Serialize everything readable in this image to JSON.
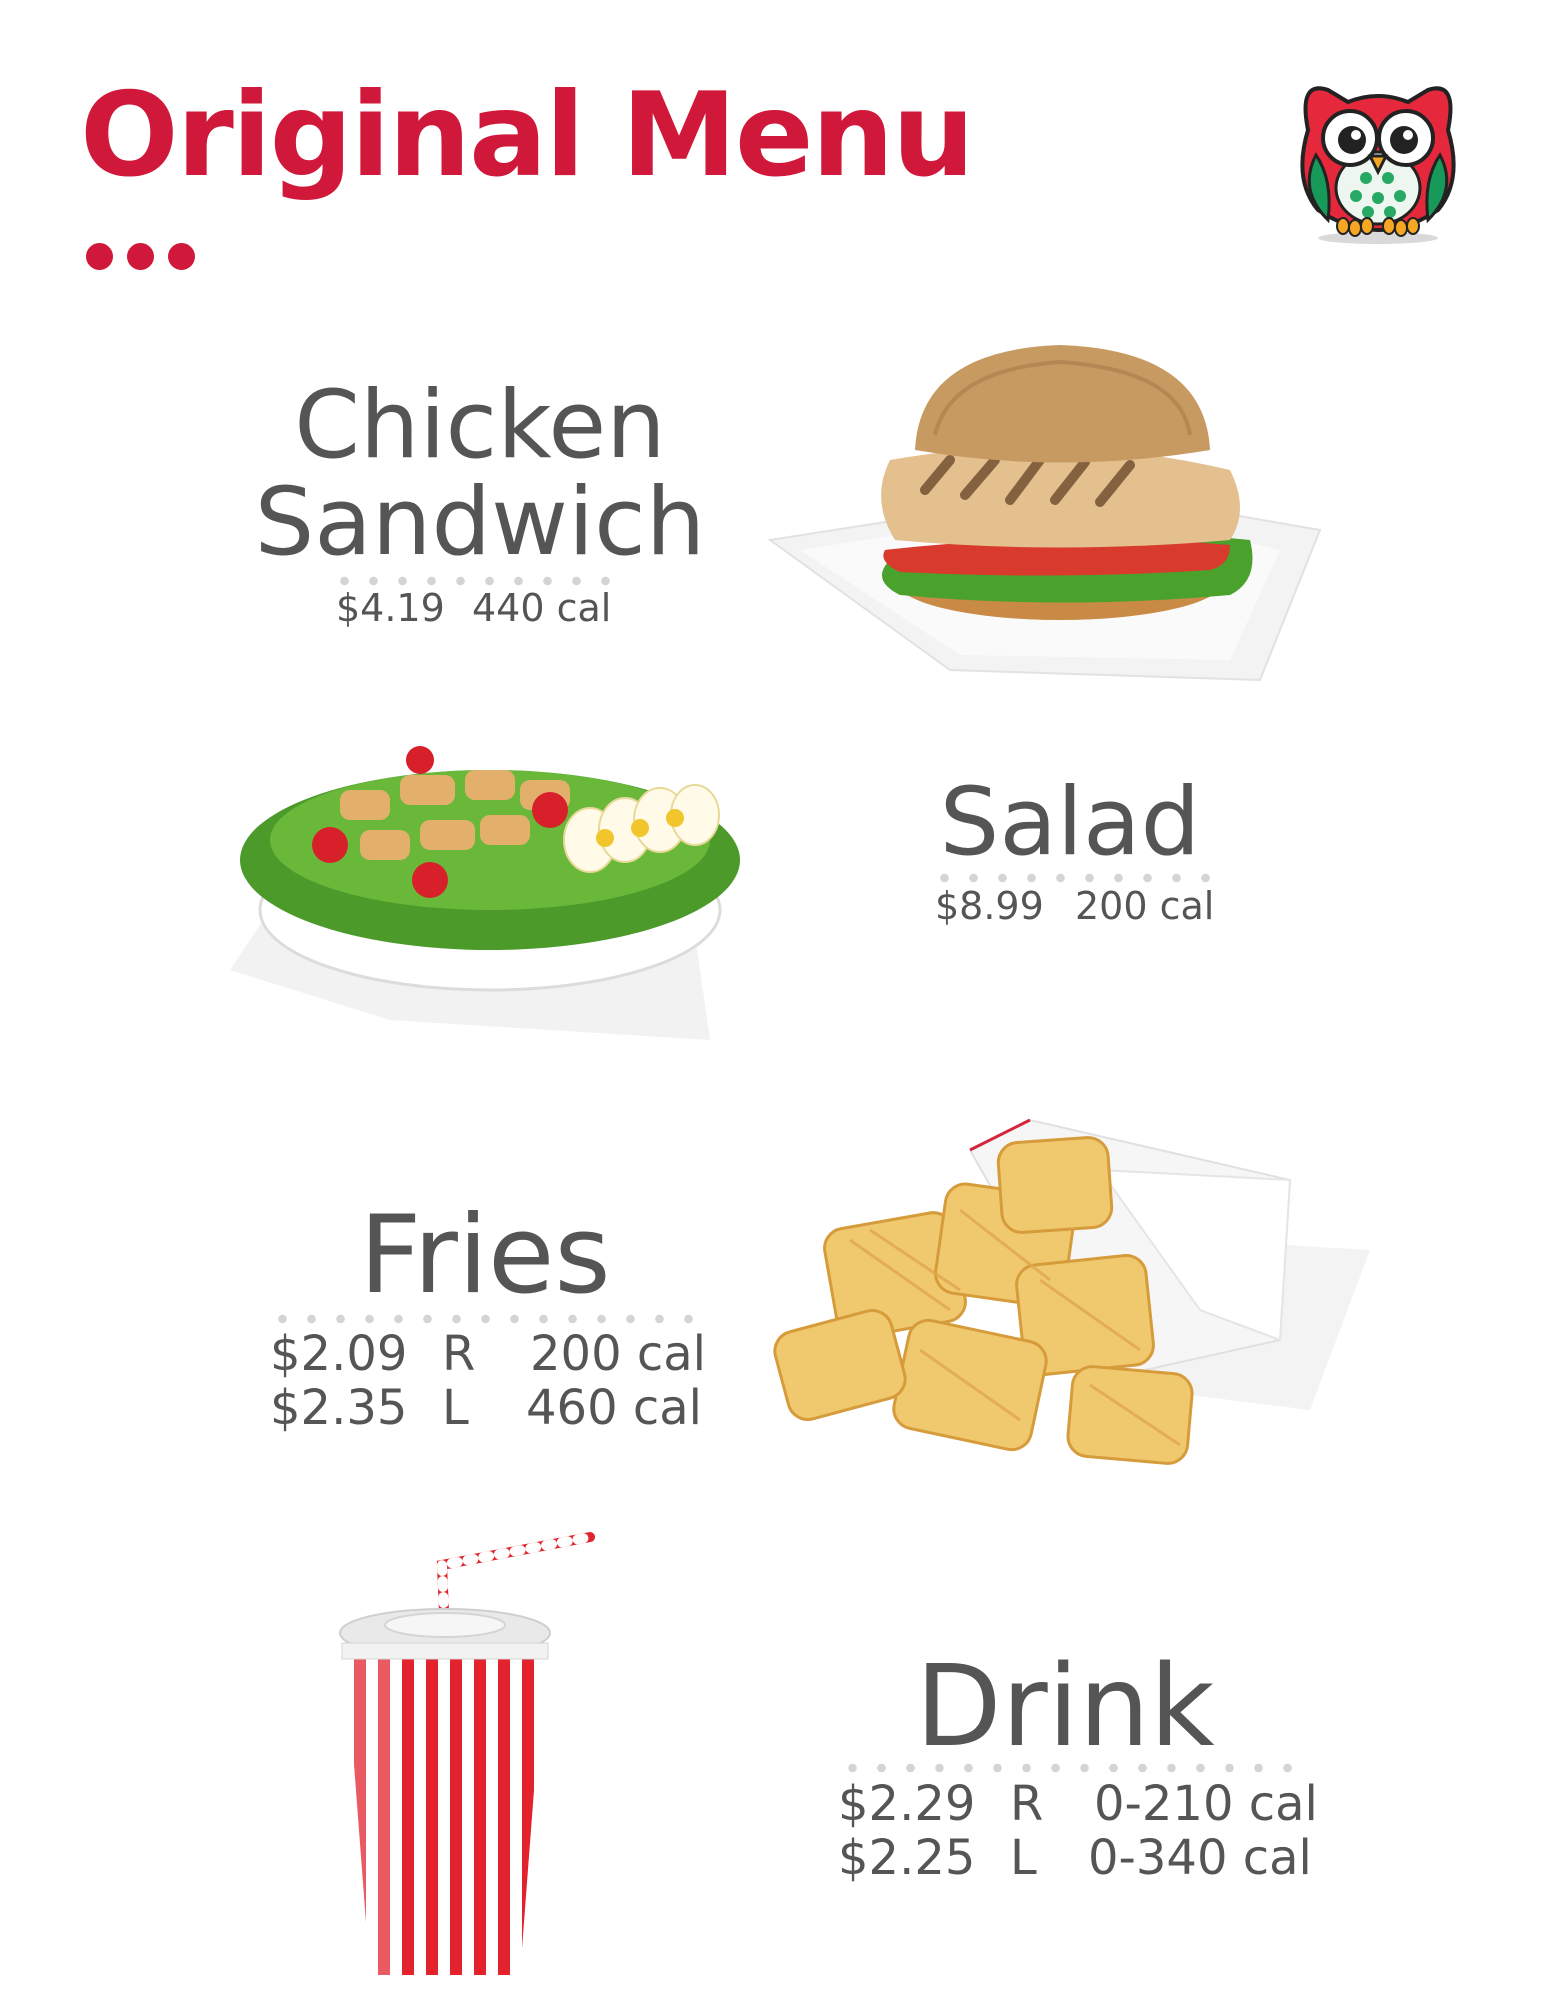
{
  "title": "Original Menu",
  "mascot": {
    "icon": "owl-mascot-icon"
  },
  "colors": {
    "brand_red": "#d0183a",
    "text_gray": "#555555"
  },
  "items": [
    {
      "name_lines": [
        "Chicken",
        "Sandwich"
      ],
      "image": "chicken-sandwich-image",
      "prices": [
        {
          "price": "$4.19",
          "size": "",
          "calories": "440 cal"
        }
      ]
    },
    {
      "name_lines": [
        "Salad"
      ],
      "image": "salad-bowl-image",
      "prices": [
        {
          "price": "$8.99",
          "size": "",
          "calories": "200 cal"
        }
      ]
    },
    {
      "name_lines": [
        "Fries"
      ],
      "image": "waffle-fries-image",
      "prices": [
        {
          "price": "$2.09",
          "size": "R",
          "calories": "200 cal"
        },
        {
          "price": "$2.35",
          "size": "L",
          "calories": "460 cal"
        }
      ]
    },
    {
      "name_lines": [
        "Drink"
      ],
      "image": "drink-cup-image",
      "prices": [
        {
          "price": "$2.29",
          "size": "R",
          "calories": "0-210  cal"
        },
        {
          "price": "$2.25",
          "size": "L",
          "calories": "0-340 cal"
        }
      ]
    }
  ]
}
